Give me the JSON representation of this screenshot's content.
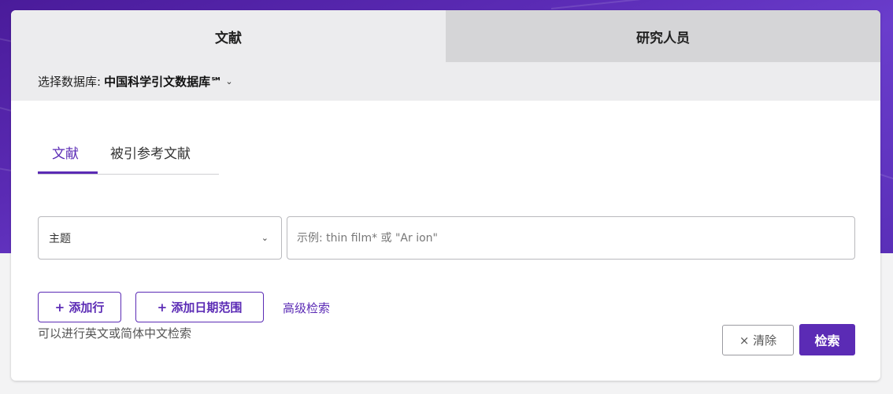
{
  "colors": {
    "accent": "#5b2bb5",
    "background_top": "#5a2fb8",
    "background_bottom": "#f3f3f4"
  },
  "main_tabs": [
    {
      "label": "文献",
      "active": true
    },
    {
      "label": "研究人员",
      "active": false
    }
  ],
  "database": {
    "label": "选择数据库:",
    "value": "中国科学引文数据库℠",
    "icon": "chevron-down-icon"
  },
  "sub_tabs": [
    {
      "label": "文献",
      "active": true
    },
    {
      "label": "被引参考文献",
      "active": false
    }
  ],
  "search_row": {
    "field": {
      "selected": "主题",
      "icon": "chevron-down-icon"
    },
    "input": {
      "value": "",
      "placeholder": "示例: thin film* 或 \"Ar ion\""
    }
  },
  "actions": {
    "add_row": "+ 添加行",
    "add_date_range": "+ 添加日期范围",
    "advanced_search": "高级检索",
    "hint": "可以进行英文或简体中文检索",
    "clear": "× 清除",
    "search": "检索"
  }
}
